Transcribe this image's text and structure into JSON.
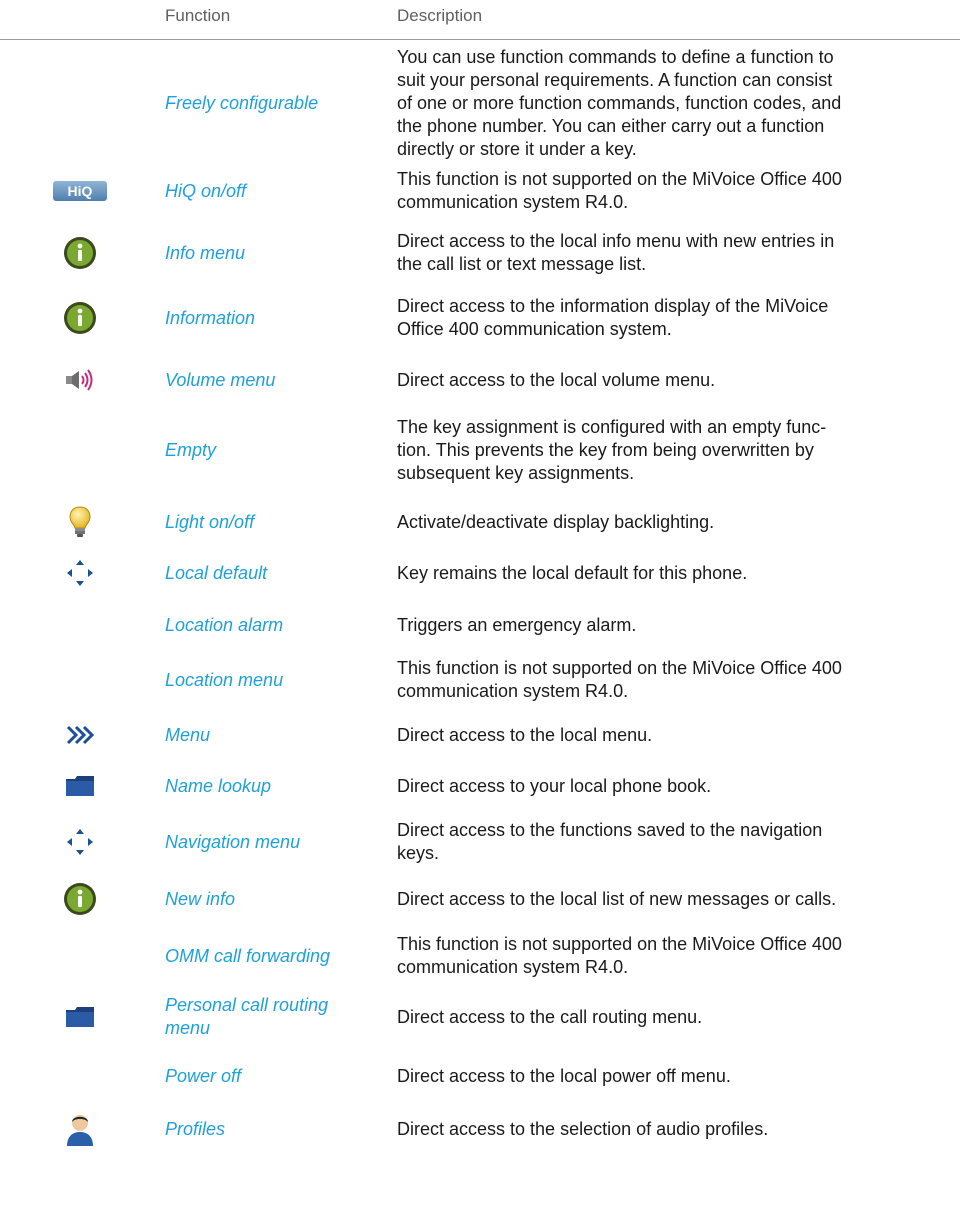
{
  "header": {
    "function": "Function",
    "description": "Description"
  },
  "rows": [
    {
      "icon": "",
      "function": "Freely configurable",
      "description": "You can use function commands to define a function to\nsuit your personal requirements. A function can consist\nof one or more function commands, function codes, and\nthe phone number. You can either carry out a function\ndirectly or store it under a key."
    },
    {
      "icon": "hiq-icon",
      "function": "HiQ on/off",
      "description": "This function is not supported on the MiVoice Office 400\ncommunication system R4.0."
    },
    {
      "icon": "info-icon",
      "function": "Info menu",
      "description": "Direct access to the local info menu with new entries in\nthe call list or text message list."
    },
    {
      "icon": "info-icon",
      "function": "Information",
      "description": "Direct access to the information display of the MiVoice\nOffice 400 communication system."
    },
    {
      "icon": "speaker-icon",
      "function": "Volume menu",
      "description": "Direct access to the local volume menu."
    },
    {
      "icon": "",
      "function": "Empty",
      "description": "The key assignment is configured with an empty func-\ntion. This prevents the key from being overwritten by\nsubsequent key assignments."
    },
    {
      "icon": "lightbulb-icon",
      "function": "Light on/off",
      "description": "Activate/deactivate display backlighting."
    },
    {
      "icon": "navigation-arrows-icon",
      "function": "Local default",
      "description": "Key remains the local default for this phone."
    },
    {
      "icon": "",
      "function": "Location alarm",
      "description": "Triggers an emergency alarm."
    },
    {
      "icon": "",
      "function": "Location menu",
      "description": "This function is not supported on the MiVoice Office 400\ncommunication system R4.0."
    },
    {
      "icon": "double-chevron-icon",
      "function": "Menu",
      "description": "Direct access to the local menu."
    },
    {
      "icon": "folder-icon",
      "function": "Name lookup",
      "description": "Direct access to your local phone book."
    },
    {
      "icon": "navigation-arrows-icon",
      "function": "Navigation menu",
      "description": "Direct access to the functions saved to the navigation\nkeys."
    },
    {
      "icon": "info-icon",
      "function": "New info",
      "description": "Direct access to the local list of new messages or calls."
    },
    {
      "icon": "",
      "function": "OMM call forwarding",
      "description": "This function is not supported on the MiVoice Office 400\ncommunication system R4.0."
    },
    {
      "icon": "folder-icon",
      "function": "Personal call routing\nmenu",
      "description": "Direct access to the call routing menu."
    },
    {
      "icon": "",
      "function": "Power off",
      "description": "Direct access to the local power off menu."
    },
    {
      "icon": "person-icon",
      "function": "Profiles",
      "description": "Direct access to the selection of audio profiles."
    }
  ]
}
